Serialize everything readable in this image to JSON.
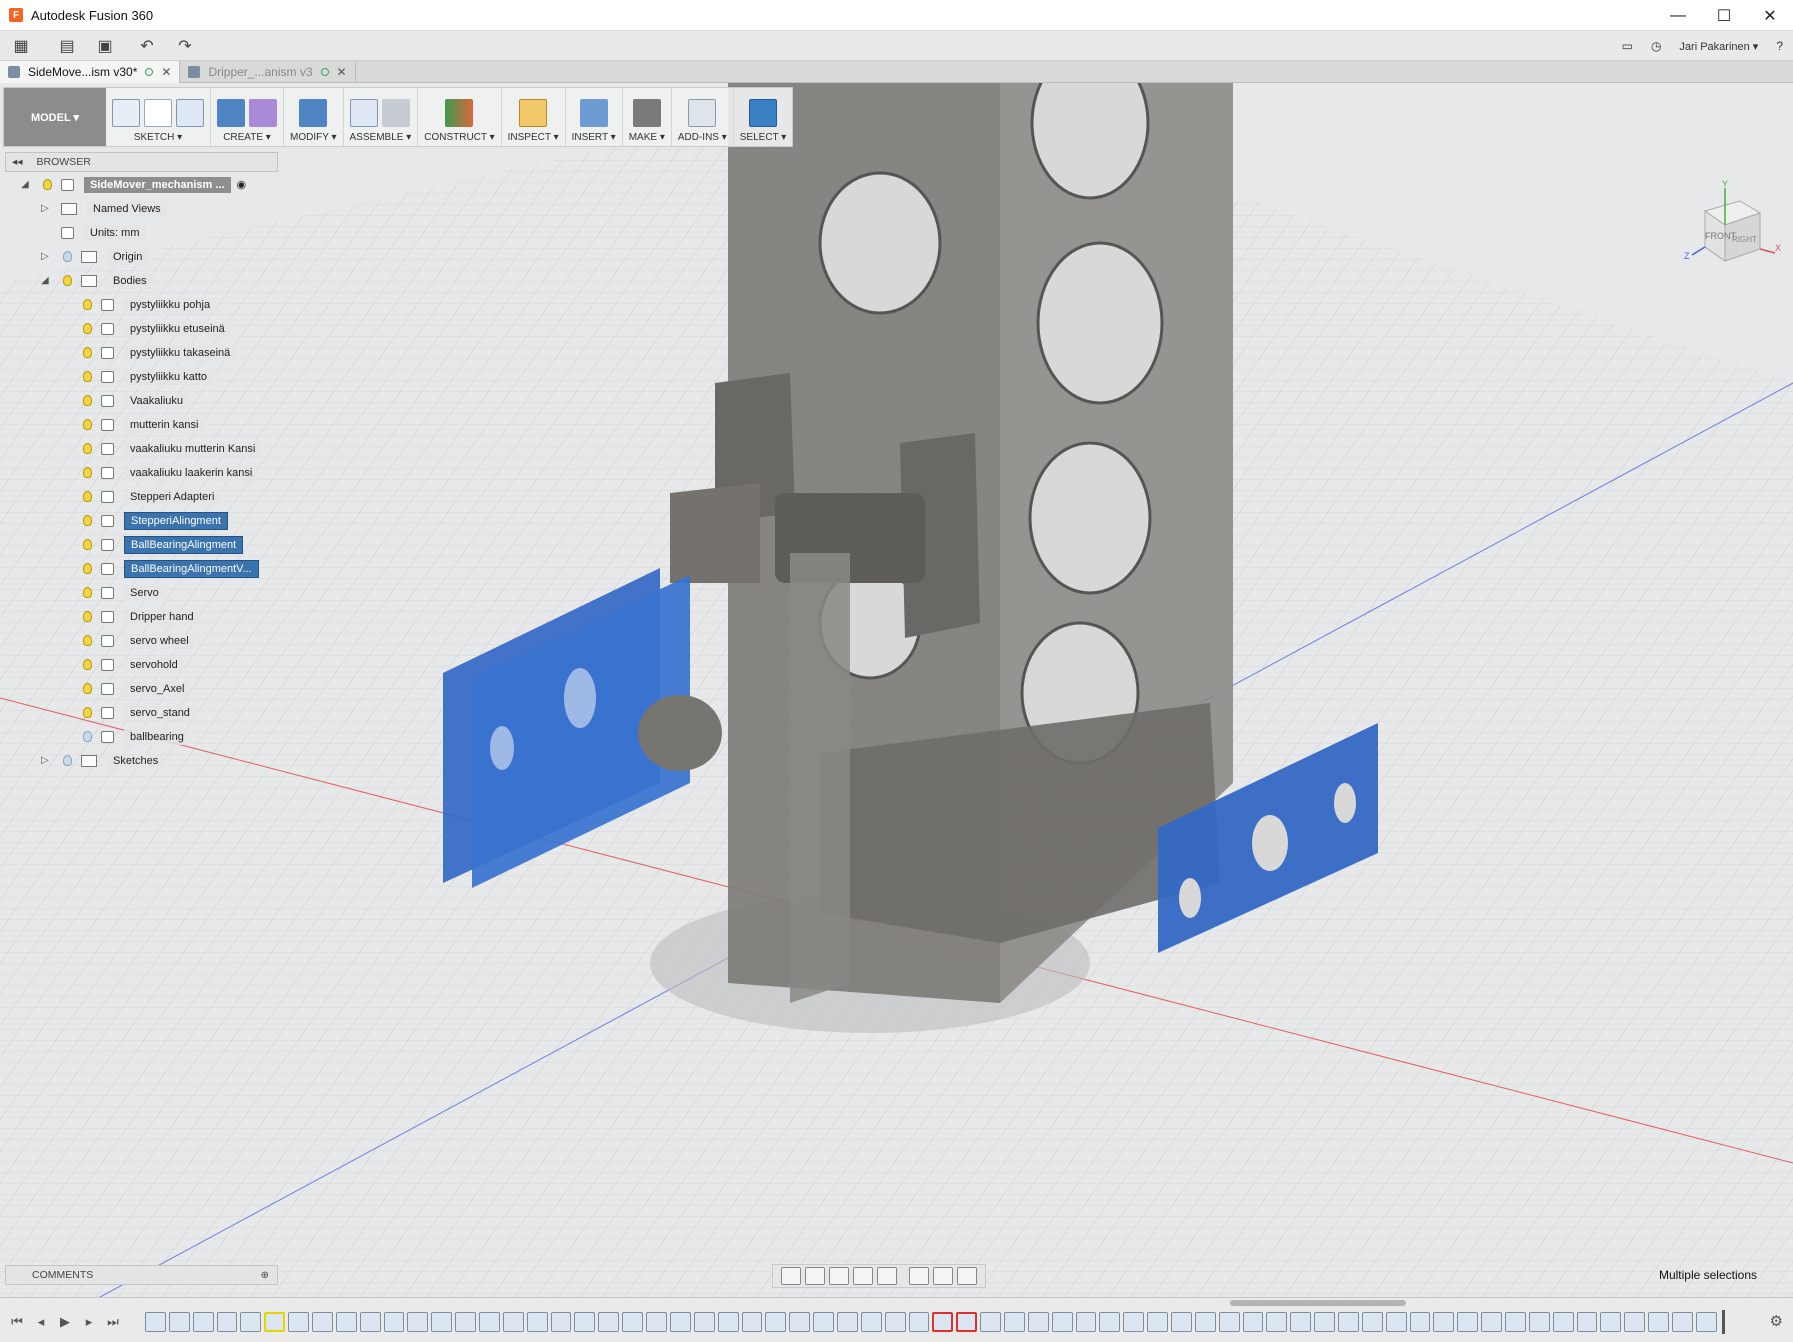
{
  "window": {
    "title": "Autodesk Fusion 360",
    "logo": "F",
    "minimize": "—",
    "maximize": "☐",
    "close": "✕"
  },
  "qat": {
    "user": "Jari Pakarinen ▾",
    "help": "?"
  },
  "tabs": [
    {
      "label": "SideMove...ism v30*",
      "state": "active"
    },
    {
      "label": "Dripper_...anism v3",
      "state": "inactive"
    }
  ],
  "toolbar": {
    "workspace": "MODEL ▾",
    "groups": [
      "SKETCH ▾",
      "CREATE ▾",
      "MODIFY ▾",
      "ASSEMBLE ▾",
      "CONSTRUCT ▾",
      "INSPECT ▾",
      "INSERT ▾",
      "MAKE ▾",
      "ADD-INS ▾",
      "SELECT ▾"
    ]
  },
  "browser": {
    "title": "BROWSER",
    "root": "SideMover_mechanism ...",
    "named_views": "Named Views",
    "units": "Units: mm",
    "origin": "Origin",
    "bodies": "Bodies",
    "sketches": "Sketches",
    "body_items": [
      {
        "label": "pystyliikku pohja",
        "selected": false
      },
      {
        "label": "pystyliikku etuseinä",
        "selected": false
      },
      {
        "label": "pystyliikku takaseinä",
        "selected": false
      },
      {
        "label": "pystyliikku katto",
        "selected": false
      },
      {
        "label": "Vaakaliuku",
        "selected": false
      },
      {
        "label": "mutterin kansi",
        "selected": false
      },
      {
        "label": "vaakaliuku mutterin Kansi",
        "selected": false
      },
      {
        "label": "vaakaliuku laakerin kansi",
        "selected": false
      },
      {
        "label": "Stepperi Adapteri",
        "selected": false
      },
      {
        "label": "StepperiAlingment",
        "selected": true
      },
      {
        "label": "BallBearingAlingment",
        "selected": true
      },
      {
        "label": "BallBearingAlingmentV...",
        "selected": true
      },
      {
        "label": "Servo",
        "selected": false
      },
      {
        "label": "Dripper hand",
        "selected": false
      },
      {
        "label": "servo wheel",
        "selected": false
      },
      {
        "label": "servohold",
        "selected": false
      },
      {
        "label": "servo_Axel",
        "selected": false
      },
      {
        "label": "servo_stand",
        "selected": false
      },
      {
        "label": "ballbearing",
        "selected": false
      }
    ]
  },
  "comments": {
    "title": "COMMENTS"
  },
  "status": {
    "selection": "Multiple selections"
  },
  "viewcube": {
    "front": "FRONT",
    "right": "RIGHT",
    "x": "X",
    "y": "Y",
    "z": "Z"
  },
  "colors": {
    "selected_body": "#3468c4",
    "selection_highlight": "#3b73ad",
    "timeline_warning": "#e03030",
    "timeline_marker": "#e4d400"
  }
}
